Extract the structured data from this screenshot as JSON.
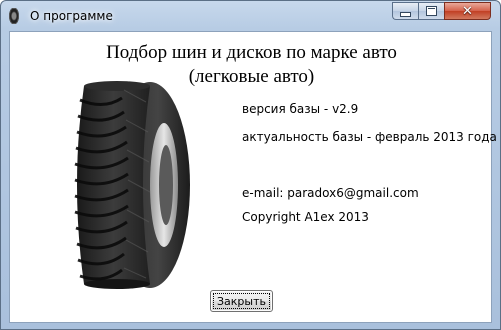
{
  "window": {
    "title": "О программе",
    "app_icon": "tire-icon"
  },
  "controls": {
    "minimize": "minimize-icon",
    "maximize": "maximize-icon",
    "close": "close-icon",
    "close_glyph": "✕"
  },
  "heading": {
    "line1": "Подбор шин и дисков по марке авто",
    "line2": "(легковые авто)"
  },
  "info": {
    "version": "версия базы - v2.9",
    "actuality": "актуальность базы - февраль 2013 года",
    "email": "e-mail: paradox6@gmail.com",
    "copyright": "Copyright A1ex 2013"
  },
  "buttons": {
    "ok_label": "Закрыть"
  },
  "colors": {
    "frame": "#b7cce4",
    "close_button": "#c13f24"
  }
}
